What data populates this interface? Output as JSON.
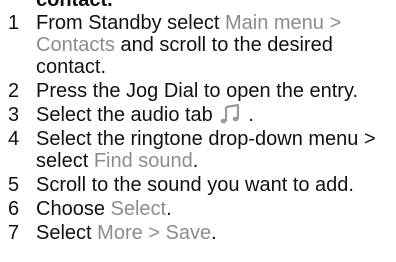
{
  "fragment": "contact.",
  "steps": [
    {
      "number": "1",
      "t1": "From Standby select ",
      "link1": "Main menu",
      "sep1": " > ",
      "link2": "Contacts",
      "t2": " and scroll to the desired contact."
    },
    {
      "number": "2",
      "text": "Press the Jog Dial to open the entry."
    },
    {
      "number": "3",
      "t1": "Select the audio tab",
      "icon": "music-note-icon",
      "t2": " ."
    },
    {
      "number": "4",
      "t1": "Select the ringtone drop-down menu > select ",
      "link1": "Find sound",
      "t2": "."
    },
    {
      "number": "5",
      "text": "Scroll to the sound you want to add."
    },
    {
      "number": "6",
      "t1": "Choose ",
      "link1": "Select",
      "t2": "."
    },
    {
      "number": "7",
      "t1": "Select ",
      "link1": "More",
      "sep1": " > ",
      "link2": "Save",
      "t2": "."
    }
  ],
  "colors": {
    "text": "#111111",
    "menu_highlight": "#8c8c8c"
  }
}
